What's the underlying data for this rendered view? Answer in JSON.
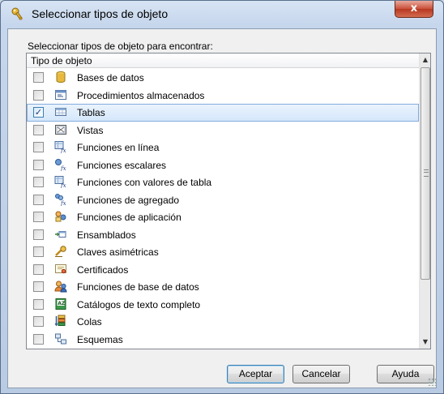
{
  "window": {
    "title": "Seleccionar tipos de objeto",
    "close_label": "x"
  },
  "prompt": "Seleccionar tipos de objeto para encontrar:",
  "list": {
    "header": "Tipo de objeto",
    "items": [
      {
        "label": "Bases de datos",
        "checked": false,
        "icon": "database-icon"
      },
      {
        "label": "Procedimientos almacenados",
        "checked": false,
        "icon": "stored-procedure-icon"
      },
      {
        "label": "Tablas",
        "checked": true,
        "selected": true,
        "icon": "table-icon"
      },
      {
        "label": "Vistas",
        "checked": false,
        "icon": "view-icon"
      },
      {
        "label": "Funciones en línea",
        "checked": false,
        "icon": "inline-function-icon"
      },
      {
        "label": "Funciones escalares",
        "checked": false,
        "icon": "scalar-function-icon"
      },
      {
        "label": "Funciones con valores de tabla",
        "checked": false,
        "icon": "table-valued-function-icon"
      },
      {
        "label": "Funciones de agregado",
        "checked": false,
        "icon": "aggregate-function-icon"
      },
      {
        "label": "Funciones de aplicación",
        "checked": false,
        "icon": "application-function-icon"
      },
      {
        "label": "Ensamblados",
        "checked": false,
        "icon": "assembly-icon"
      },
      {
        "label": "Claves asimétricas",
        "checked": false,
        "icon": "asymmetric-key-icon"
      },
      {
        "label": "Certificados",
        "checked": false,
        "icon": "certificate-icon"
      },
      {
        "label": "Funciones de base de datos",
        "checked": false,
        "icon": "database-role-icon"
      },
      {
        "label": "Catálogos de texto completo",
        "checked": false,
        "icon": "fulltext-catalog-icon"
      },
      {
        "label": "Colas",
        "checked": false,
        "icon": "queue-icon"
      },
      {
        "label": "Esquemas",
        "checked": false,
        "icon": "schema-icon"
      }
    ]
  },
  "buttons": {
    "accept": "Aceptar",
    "cancel": "Cancelar",
    "help": "Ayuda"
  },
  "colors": {
    "selection_border": "#84acdd",
    "selection_fill": "#d5e7fb",
    "close_button": "#c9503a"
  }
}
